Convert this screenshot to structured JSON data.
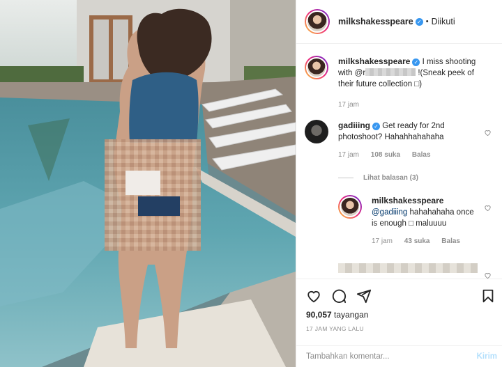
{
  "post": {
    "username": "milkshakesspeare",
    "follow_status": "Diikuti",
    "views": "90,057",
    "views_label": "tayangan",
    "posted_time": "17 JAM YANG LALU"
  },
  "comments": [
    {
      "username": "milkshakesspeare",
      "text_before": "I miss shooting with @r",
      "text_after": " !(Sneak peek of their future collection □)",
      "age": "17 jam"
    },
    {
      "username": "gadiiing",
      "text": "Get ready for 2nd photoshoot? Hahahhahahaha",
      "age": "17 jam",
      "likes": "108 suka",
      "reply": "Balas"
    },
    {
      "username": "milkshakesspeare",
      "mention": "@gadiiing",
      "text": " hahahahaha once is enough □ maluuuu",
      "age": "17 jam",
      "likes": "43 suka",
      "reply": "Balas"
    }
  ],
  "view_replies": "Lihat balasan (3)",
  "add_comment": {
    "placeholder": "Tambahkan komentar...",
    "post_label": "Kirim"
  },
  "icons": [
    "heart-icon",
    "comment-icon",
    "share-icon",
    "bookmark-icon",
    "verified-icon"
  ],
  "colors": {
    "verified": "#3897f0",
    "post_button": "#b2dffc",
    "muted": "#8e8e8e"
  }
}
